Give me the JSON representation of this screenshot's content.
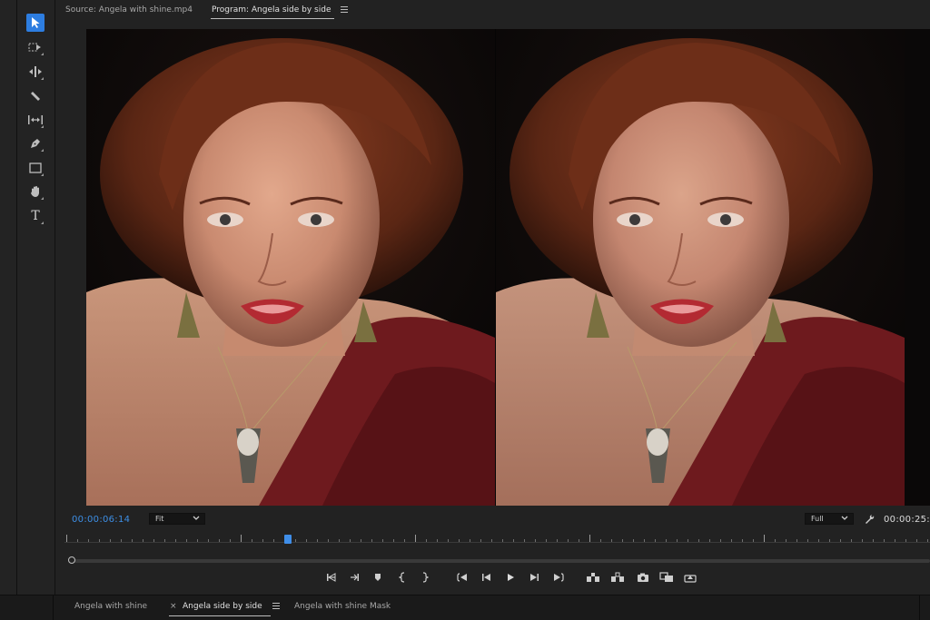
{
  "source_monitor": {
    "tab_label": "Source: Angela with shine.mp4"
  },
  "program_monitor": {
    "tab_label": "Program: Angela side by side",
    "timecode_current": "00:00:06:14",
    "timecode_duration": "00:00:25:",
    "zoom_select": {
      "selected": "Fit"
    },
    "resolution_select": {
      "selected": "Full"
    }
  },
  "tools": [
    {
      "name": "selection-tool-icon",
      "active": true
    },
    {
      "name": "track-select-tool-icon"
    },
    {
      "name": "ripple-edit-tool-icon"
    },
    {
      "name": "razor-tool-icon"
    },
    {
      "name": "slip-tool-icon"
    },
    {
      "name": "pen-tool-icon"
    },
    {
      "name": "rectangle-tool-icon"
    },
    {
      "name": "hand-tool-icon"
    },
    {
      "name": "type-tool-icon",
      "glyph": "T"
    }
  ],
  "transport": [
    "mark-in-icon",
    "mark-out-icon",
    "add-marker-icon",
    "clear-in-icon",
    "clear-out-icon",
    "go-to-in-icon",
    "step-back-icon",
    "play-icon",
    "step-forward-icon",
    "go-to-out-icon",
    "lift-icon",
    "extract-icon",
    "export-frame-icon",
    "comparison-view-icon",
    "proxy-toggle-icon"
  ],
  "bottom_tabs": [
    {
      "label": "Angela with shine"
    },
    {
      "label": "Angela side by side",
      "active": true,
      "close_glyph": "×"
    },
    {
      "label": "Angela with shine Mask"
    }
  ],
  "colors": {
    "accent": "#2d7de0",
    "timecode": "#3d8fe6",
    "panel_bg": "#222222"
  }
}
